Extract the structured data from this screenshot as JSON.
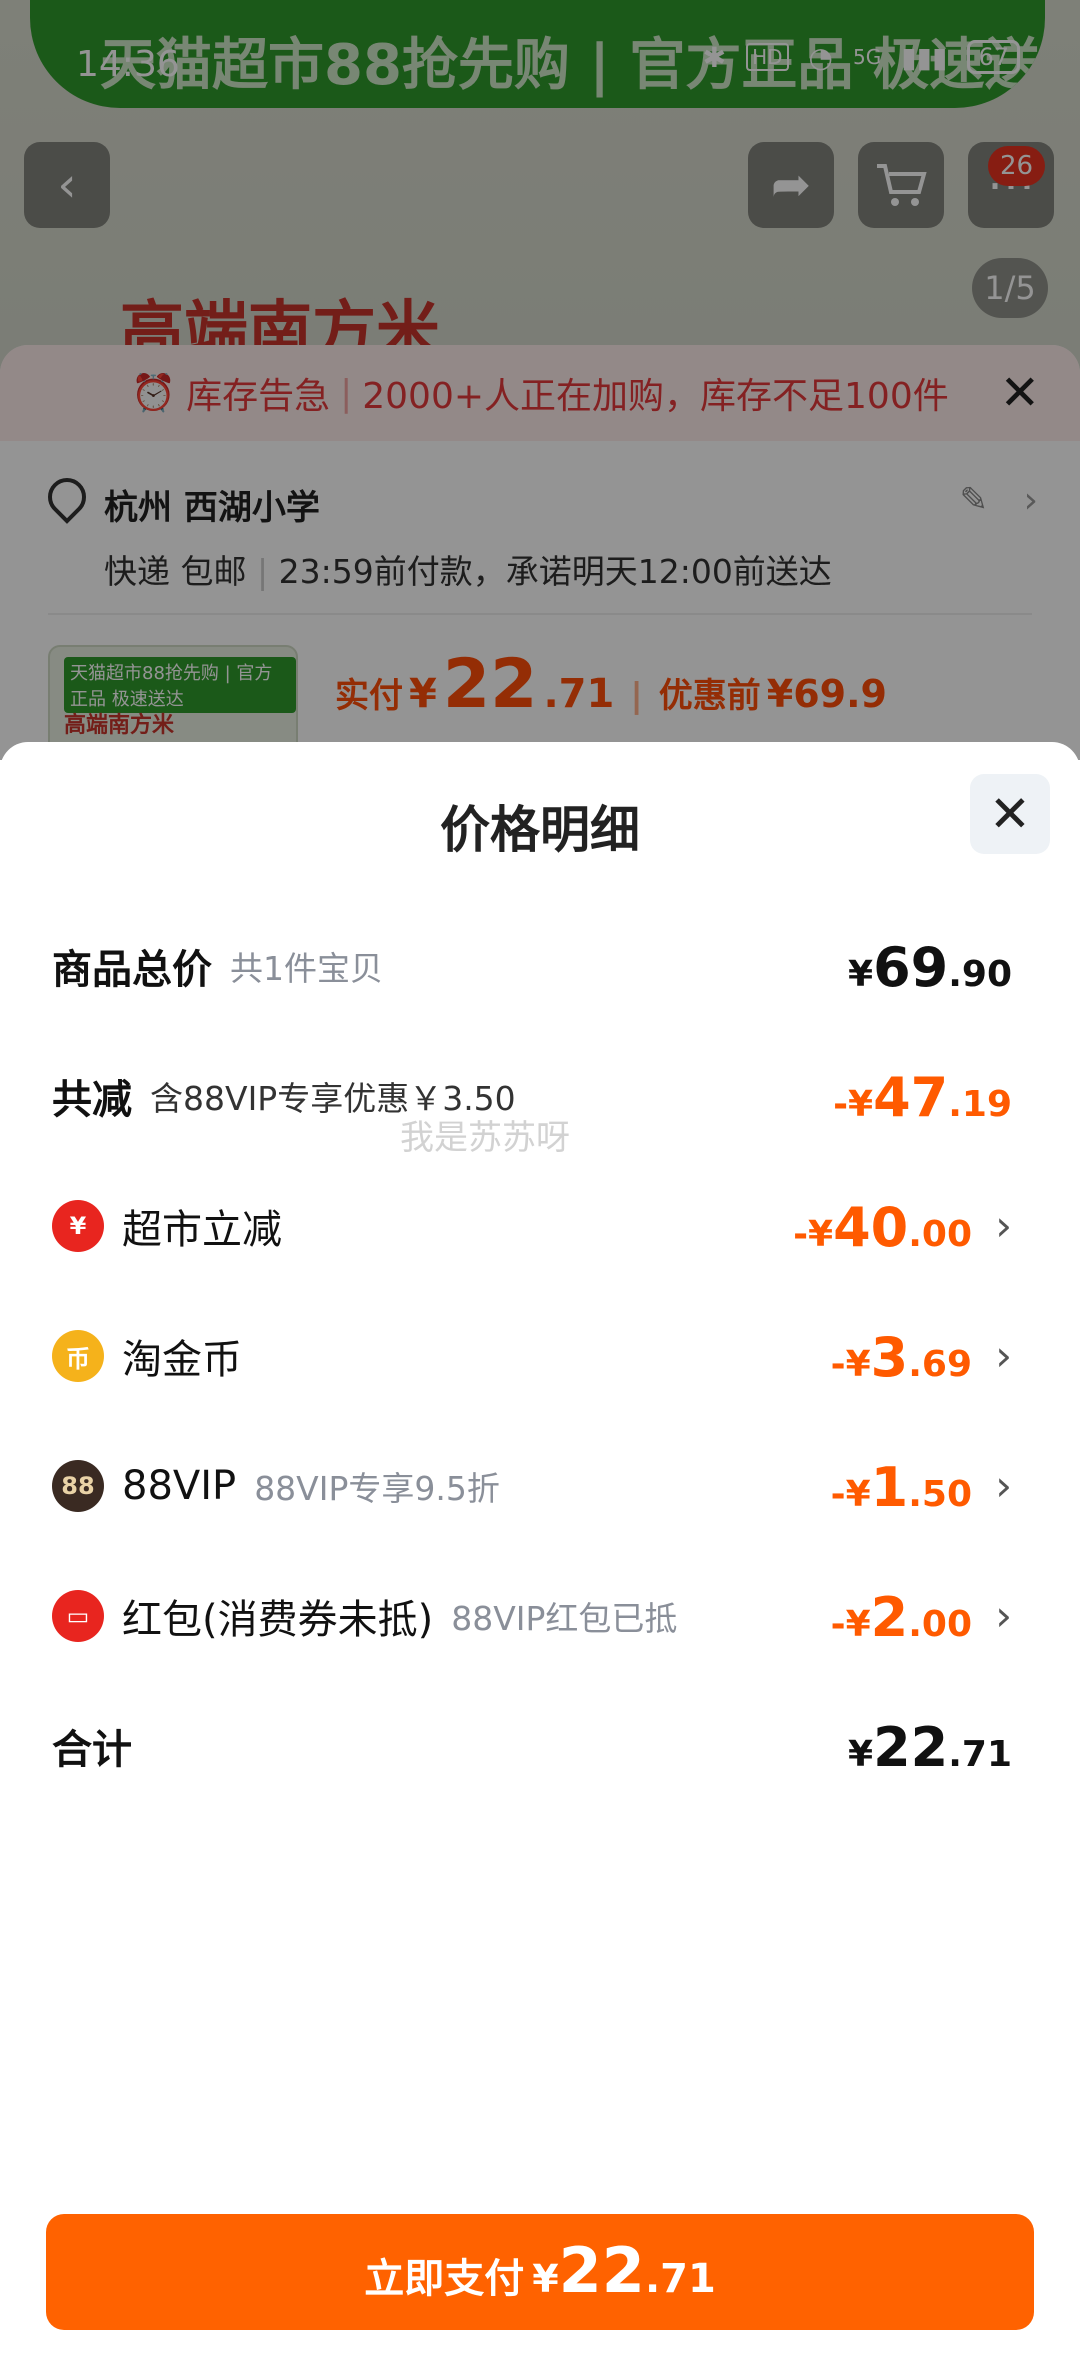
{
  "status_bar": {
    "time": "14:36",
    "network": "5G",
    "hd": "HD",
    "battery": "67"
  },
  "background": {
    "banner_text": "天猫超市88抢先购 | 官方正品 极速送达",
    "cart_badge": "26",
    "image_counter": "1/5",
    "product_title": "高端南方米",
    "stock_alert": {
      "label": "库存告急",
      "text": "2000+人正在加购，库存不足100件"
    },
    "address": {
      "city_school": "杭州 西湖小学",
      "delivery": "快递 包邮",
      "promise": "23:59前付款，承诺明天12:00前送达"
    },
    "thumb_brand": "天猫超市88抢先购 | 官方正品 极速送达",
    "thumb_text": "高端南方米",
    "summary": {
      "paid_label": "实付",
      "yen": "¥",
      "paid_int": "22",
      "paid_dec": ".71",
      "before_label": "优惠前",
      "before_value": "¥69.9"
    }
  },
  "panel": {
    "title": "价格明细",
    "rows": {
      "total": {
        "label": "商品总价",
        "sub": "共1件宝贝",
        "yen": "¥",
        "int": "69",
        "dec": ".90"
      },
      "discount": {
        "label": "共减",
        "sub": "含88VIP专享优惠￥3.50",
        "yen": "-¥",
        "int": "47",
        "dec": ".19"
      },
      "supermarket": {
        "label": "超市立减",
        "yen": "-¥",
        "int": "40",
        "dec": ".00"
      },
      "coins": {
        "label": "淘金币",
        "yen": "-¥",
        "int": "3",
        "dec": ".69"
      },
      "vip": {
        "label": "88VIP",
        "sub": "88VIP专享9.5折",
        "yen": "-¥",
        "int": "1",
        "dec": ".50"
      },
      "redpacket": {
        "label": "红包(消费券未抵)",
        "sub": "88VIP红包已抵",
        "yen": "-¥",
        "int": "2",
        "dec": ".00"
      },
      "sum": {
        "label": "合计",
        "yen": "¥",
        "int": "22",
        "dec": ".71"
      }
    },
    "watermark": "我是苏苏呀"
  },
  "pay_button": {
    "label": "立即支付",
    "yen": "¥",
    "int": "22",
    "dec": ".71"
  },
  "colors": {
    "accent": "#ff6200",
    "discount": "#ff5a00",
    "alert": "#e4393c",
    "brand_green": "#2f9a2c"
  }
}
